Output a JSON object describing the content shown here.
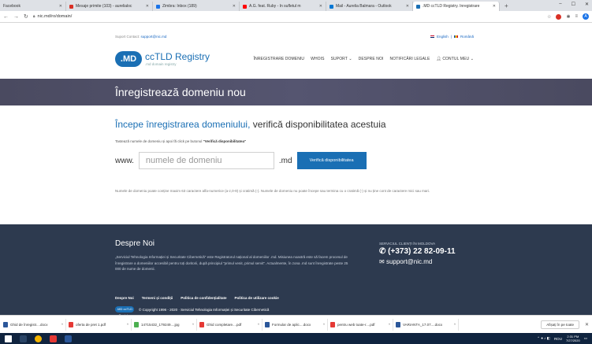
{
  "browser": {
    "tabs": [
      {
        "title": "Facebook",
        "color": "#3b5998"
      },
      {
        "title": "Mesaje primite (103) - aurelialoc",
        "color": "#d93025"
      },
      {
        "title": "Zimbra: Inbox (189)",
        "color": "#1a73e8"
      },
      {
        "title": "A.G. feat. Ruby - În sufletul m",
        "color": "#ff0000"
      },
      {
        "title": "Mail - Aurelia Balmara - Outlook",
        "color": "#0078d4"
      },
      {
        "title": ".MD ccTLD Registry. Înregistrare",
        "color": "#1a6fb4"
      }
    ],
    "url": "nic.md/ro/domain/"
  },
  "topbar": {
    "support_label": "Suport Contact:",
    "support_email": "support@nic.md",
    "lang_en": "English",
    "lang_ro": "Română"
  },
  "logo": {
    "badge": ".MD",
    "title": "ccTLD Registry",
    "subtitle": ".md domain registry"
  },
  "nav": {
    "register": "ÎNREGISTRARE DOMENIU",
    "whois": "WHOIS",
    "support": "SUPORT ⌄",
    "about": "DESPRE NOI",
    "legal": "NOTIFICĂRI LEGALE",
    "account": "CONTUL MEU ⌄"
  },
  "hero": {
    "title": "Înregistrează domeniu nou"
  },
  "main": {
    "heading_blue": "Începe înregistrarea domeniului,",
    "heading_dark": " verifică disponibilitatea acestuia",
    "instruction_pre": "Tastează numele de domeniu și apoi fă click pe butonul ",
    "instruction_bold": "\"Verifică disponibilitatea\"",
    "www": "www.",
    "input_placeholder": "numele de domeniu",
    "tld": ".md",
    "check_button": "Verifică disponibilitatea",
    "note": "Numele de domeniu poate conține maxim 63 caractere alfa-numerice (a-z,0-9) și cratimă (-). Numele de domeniu nu poate începe sau termina cu o cratimă (-) și nu ține cont de caractere mici sau mari."
  },
  "footer": {
    "title": "Despre Noi",
    "text": "„Serviciul Tehnologia Informației și Securitate Cibernetică\" este Registratorul național al domeniilor .md. Misiunea noastră este să facem procesul de înregistrare a domeniilor accesibil pentru toți doritorii, după principiul \"primul venit, primul servit\". Actualmente, în zona .md sunt înregistrate peste 25 000 de nume de domenii.",
    "contact_label": "SERVICIUL CLIENȚI ÎN MOLDOVA",
    "phone": "(+373) 22 82-09-11",
    "email": "support@nic.md",
    "links": [
      "Despre Noi",
      "Termeni și condiții",
      "Politica de confidențialitate",
      "Politica de utilizare cookie"
    ],
    "mini_logo": ".MD ccTLD Registry",
    "copyright": "© Copyright 1996 - 2020 · Serviciul Tehnologia Informației și Securitate Cibernetică"
  },
  "downloads": {
    "items": [
      {
        "name": "Ghid de înregistr....docx",
        "color": "#2b579a"
      },
      {
        "name": "oferta de pret 1.pdf",
        "color": "#e53935"
      },
      {
        "name": "14715432_179249....jpg",
        "color": "#4caf50"
      },
      {
        "name": "Ghid completare....pdf",
        "color": "#e53935"
      },
      {
        "name": "Formular de aplic....docx",
        "color": "#2b579a"
      },
      {
        "name": "pentru web toate-r....pdf",
        "color": "#e53935"
      },
      {
        "name": "VARIANTA_17.07....docx",
        "color": "#2b579a"
      }
    ],
    "show_all": "Afișați în pe toate"
  },
  "taskbar": {
    "lang": "ROU",
    "time": "2:31 PM",
    "date": "7/27/2020"
  }
}
